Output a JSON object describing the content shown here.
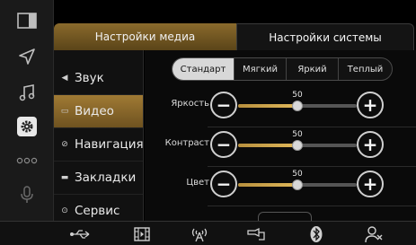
{
  "tabs": {
    "media_label": "Настройки медиа",
    "system_label": "Настройки системы"
  },
  "menu": {
    "items": [
      {
        "label": "Звук",
        "icon": "speaker-icon",
        "glyph": "◀"
      },
      {
        "label": "Видео",
        "icon": "video-icon",
        "glyph": "▭",
        "active": true
      },
      {
        "label": "Навигация",
        "icon": "navigation-icon",
        "glyph": "⊘"
      },
      {
        "label": "Закладки",
        "icon": "bookmark-icon",
        "glyph": "▬"
      },
      {
        "label": "Сервис",
        "icon": "service-icon",
        "glyph": "⊙"
      }
    ]
  },
  "presets": {
    "items": [
      "Стандарт",
      "Мягкий",
      "Яркий",
      "Теплый"
    ],
    "selected": "Стандарт"
  },
  "sliders": [
    {
      "label": "Яркость",
      "value": "50",
      "level": 0.5
    },
    {
      "label": "Контраст",
      "value": "50",
      "level": 0.5
    },
    {
      "label": "Цвет",
      "value": "50",
      "level": 0.5
    }
  ],
  "colors": {
    "accent": "#a07a34",
    "accent_light": "#e0b85a"
  },
  "left_rail": [
    "split-screen-icon",
    "navigation-arrow-icon",
    "music-note-icon",
    "gear-icon",
    "more-dots-icon",
    "microphone-icon",
    "back-icon"
  ],
  "bottom_bar": [
    "usb-icon",
    "film-icon",
    "radio-antenna-icon",
    "carplay-icon",
    "bluetooth-icon",
    "phone-contact-icon"
  ]
}
